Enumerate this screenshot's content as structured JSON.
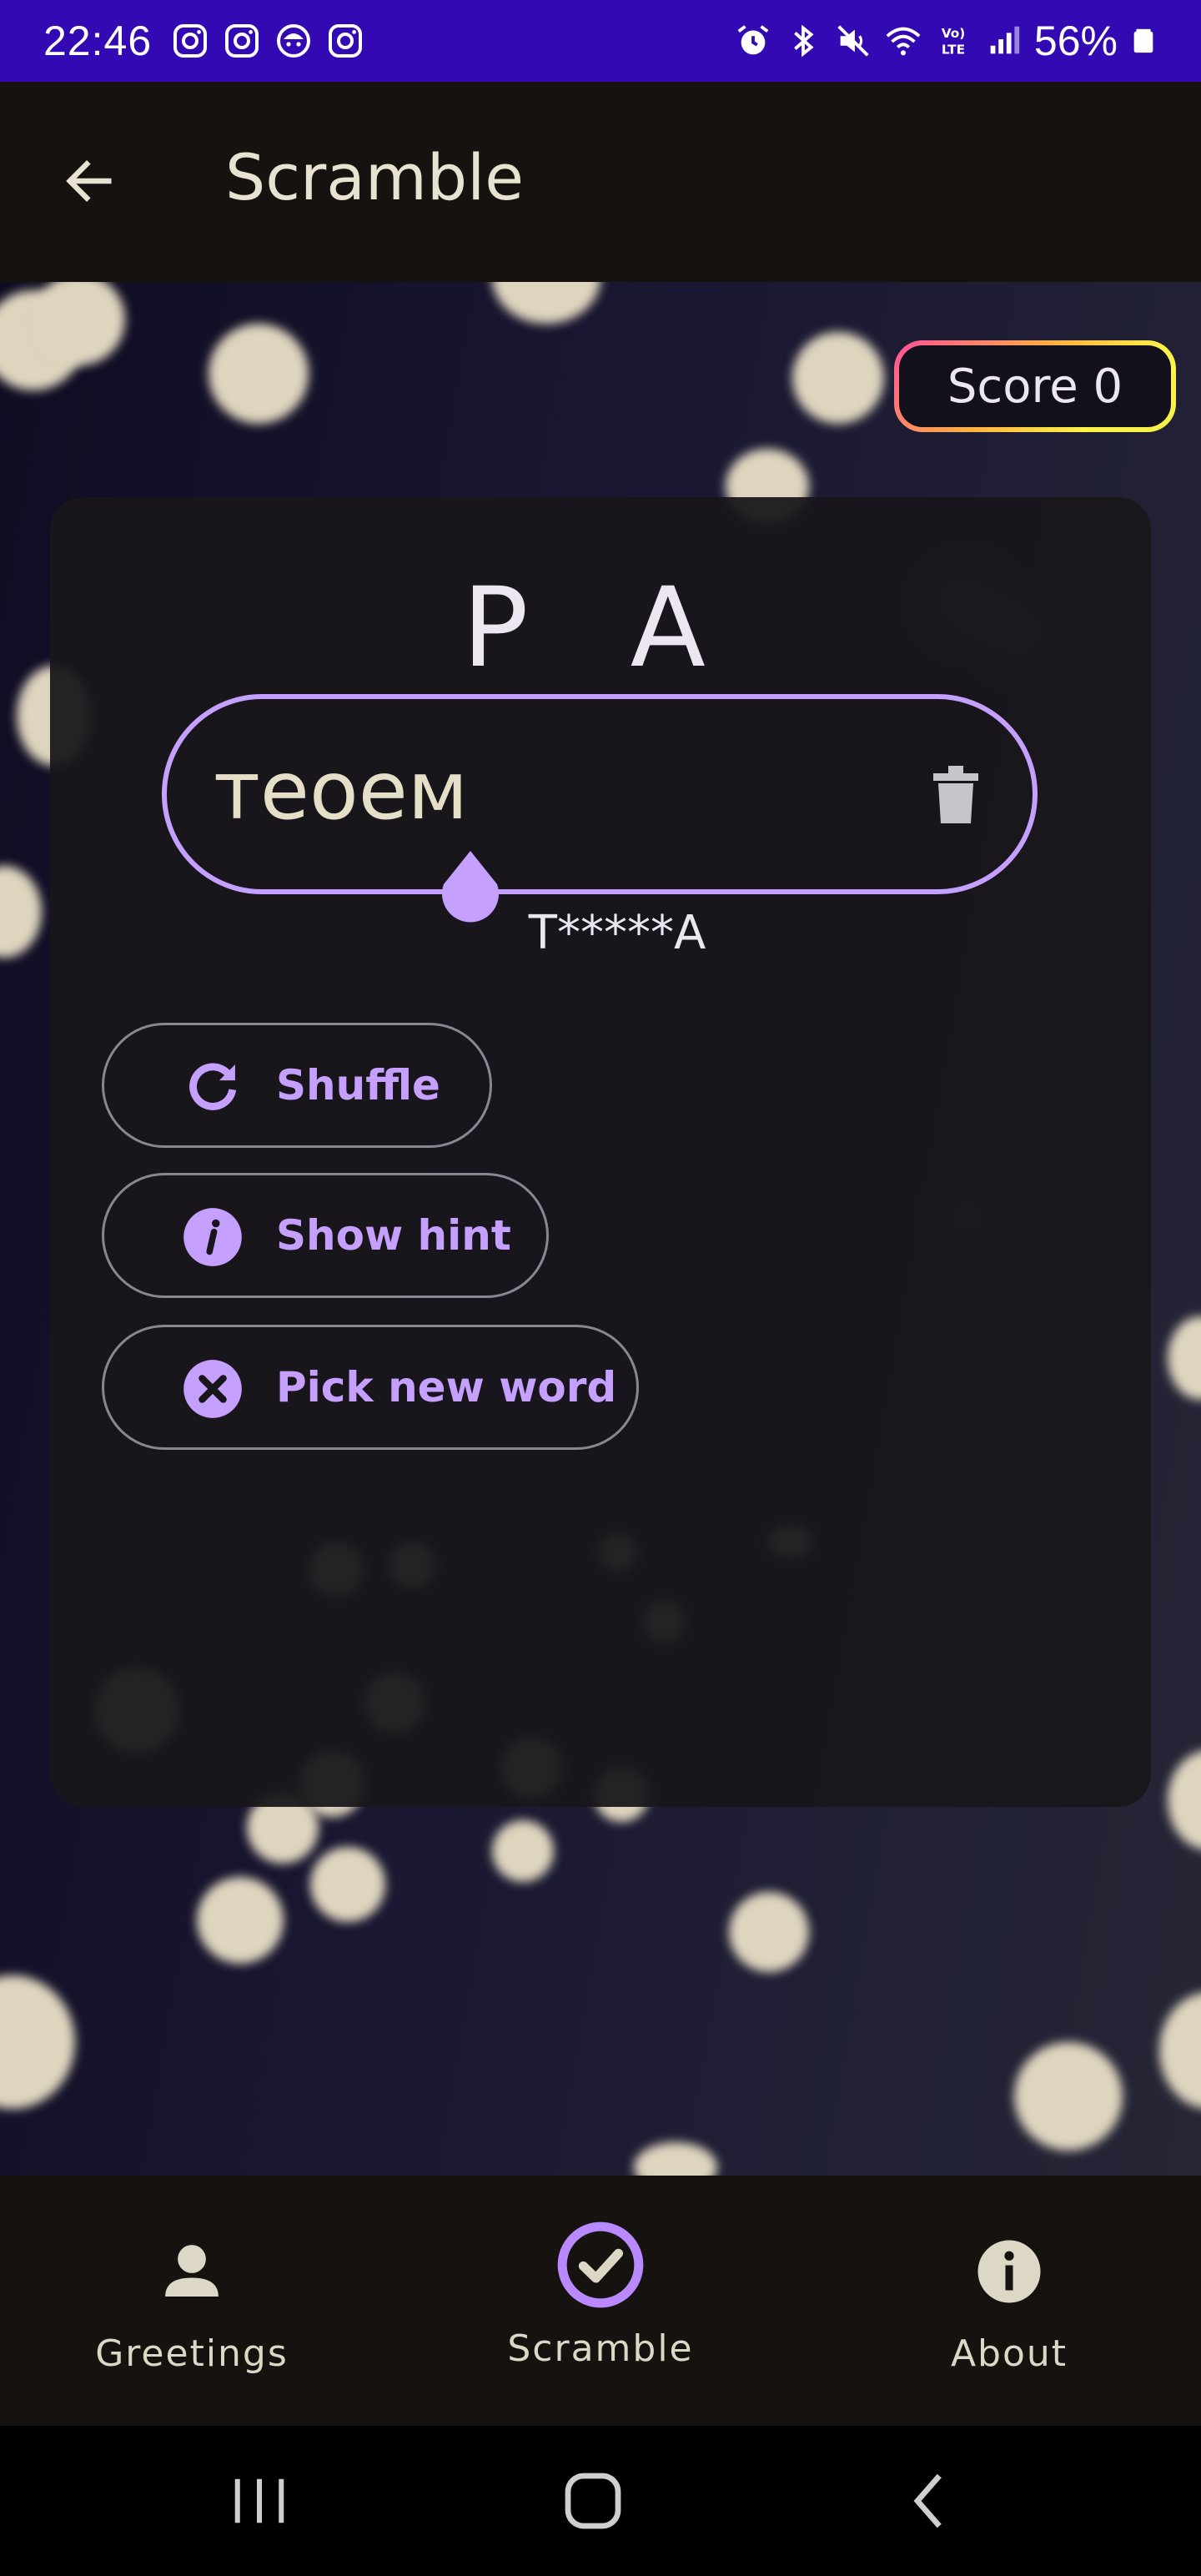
{
  "status_bar": {
    "time": "22:46",
    "notification_icons": [
      "instagram-icon",
      "instagram-icon",
      "app-icon",
      "instagram-icon"
    ],
    "system_icons": [
      "alarm-icon",
      "bluetooth-icon",
      "mute-icon",
      "wifi-icon",
      "volte-icon",
      "signal-icon"
    ],
    "battery_percent": "56%"
  },
  "app_bar": {
    "title": "Scramble",
    "back_icon": "arrow-back-icon"
  },
  "score": {
    "label": "Score 0"
  },
  "game": {
    "scrambled_word": "Р А",
    "guess_value": "теоем",
    "hint_text": "Т*****А",
    "clear_icon": "trash-icon"
  },
  "actions": {
    "shuffle_label": "Shuffle",
    "hint_label": "Show hint",
    "new_word_label": "Pick new word"
  },
  "bottom_nav": {
    "items": [
      {
        "label": "Greetings",
        "icon": "person-icon",
        "selected": false
      },
      {
        "label": "Scramble",
        "icon": "check-circle-icon",
        "selected": true
      },
      {
        "label": "About",
        "icon": "info-icon",
        "selected": false
      }
    ]
  },
  "colors": {
    "status_bar": "#3209b3",
    "accent": "#c6a0ff",
    "app_bar": "#15120f",
    "card": "#18161b"
  }
}
